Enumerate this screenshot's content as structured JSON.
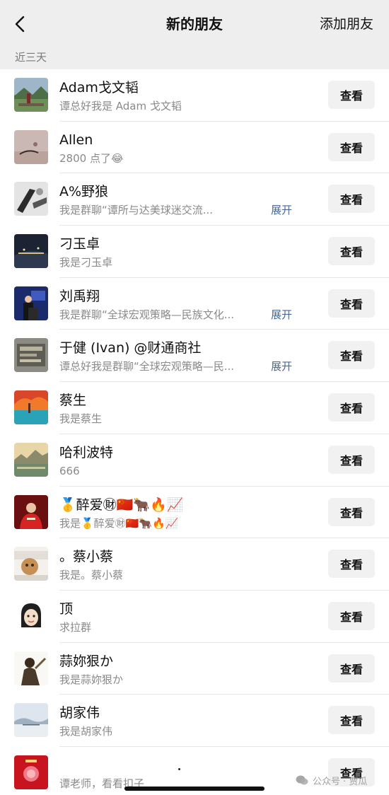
{
  "navbar": {
    "title": "新的朋友",
    "action": "添加朋友",
    "back_icon": "chevron-left-icon"
  },
  "section": {
    "label": "近三天"
  },
  "button_label": "查看",
  "expand_label": "展开",
  "rows": [
    {
      "name": "Adam戈文韬",
      "sub": "谭总好我是 Adam 戈文韬",
      "expand": false
    },
    {
      "name": "Allen",
      "sub": "2800 点了😂",
      "expand": false
    },
    {
      "name": "A%野狼",
      "sub": "我是群聊“谭所与达美球迷交流...",
      "expand": true
    },
    {
      "name": "刁玉卓",
      "sub": "我是刁玉卓",
      "expand": false
    },
    {
      "name": "刘禹翔",
      "sub": "我是群聊“全球宏观策略—民族文化...",
      "expand": true
    },
    {
      "name": "于健 (Ivan) @财通商社",
      "sub": "谭总好我是群聊“全球宏观策略—民...",
      "expand": true
    },
    {
      "name": "蔡生",
      "sub": "我是蔡生",
      "expand": false
    },
    {
      "name": "哈利波特",
      "sub": "666",
      "expand": false
    },
    {
      "name": "🥇醉爱㊖🇨🇳🐂🔥📈",
      "sub": "我是🥇醉爱㊖🇨🇳🐂🔥📈",
      "expand": false
    },
    {
      "name": "。蔡小蔡",
      "sub": "我是。蔡小蔡",
      "expand": false
    },
    {
      "name": "顶",
      "sub": "求拉群",
      "expand": false
    },
    {
      "name": "蒜妳狠か",
      "sub": "我是蒜妳狠か",
      "expand": false
    },
    {
      "name": "胡家伟",
      "sub": "我是胡家伟",
      "expand": false
    },
    {
      "name": "",
      "sub": "谭老师，看看扣子",
      "expand": false
    }
  ],
  "watermark": {
    "text": "公众号 · 贾瓜"
  },
  "colors": {
    "navbar_bg": "#eeeeee",
    "link_blue": "#4a6894",
    "button_bg": "#f1f1f1"
  }
}
